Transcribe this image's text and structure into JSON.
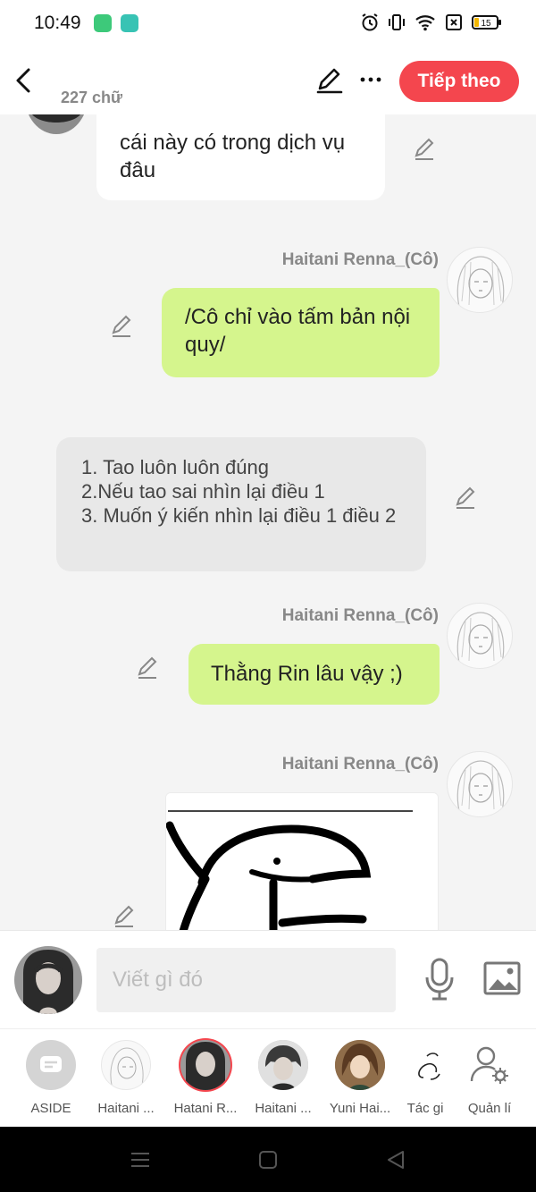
{
  "status_bar": {
    "time": "10:49",
    "battery": "15"
  },
  "header": {
    "word_count": "227 chữ",
    "next_label": "Tiếp theo"
  },
  "messages": [
    {
      "type": "text",
      "side": "left",
      "text": "cái này có trong dịch vụ đâu"
    },
    {
      "type": "text",
      "side": "right",
      "sender": "Haitani Renna_(Cô)",
      "text": "/Cô chỉ vào tấm bản nội quy/"
    },
    {
      "type": "aside",
      "text": "1. Tao luôn luôn đúng\n2.Nếu tao sai nhìn lại điều 1\n3. Muốn ý kiến nhìn lại điều 1 điều 2"
    },
    {
      "type": "text",
      "side": "right",
      "sender": "Haitani Renna_(Cô)",
      "text": "Thằng Rin lâu vậy ;)"
    },
    {
      "type": "image",
      "side": "right",
      "sender": "Haitani Renna_(Cô)"
    }
  ],
  "input": {
    "placeholder": "Viết gì đó"
  },
  "characters": [
    {
      "label": "ASIDE",
      "icon": "aside-icon"
    },
    {
      "label": "Haitani ..."
    },
    {
      "label": "Hatani R...",
      "selected": true
    },
    {
      "label": "Haitani ..."
    },
    {
      "label": "Yuni Hai..."
    },
    {
      "label": "Tác gi"
    },
    {
      "label": "Quản lí",
      "icon": "manage-icon"
    }
  ],
  "colors": {
    "accent": "#f4464e",
    "bubble_green": "#d5f58d",
    "aside_bubble": "#e8e8e8"
  }
}
